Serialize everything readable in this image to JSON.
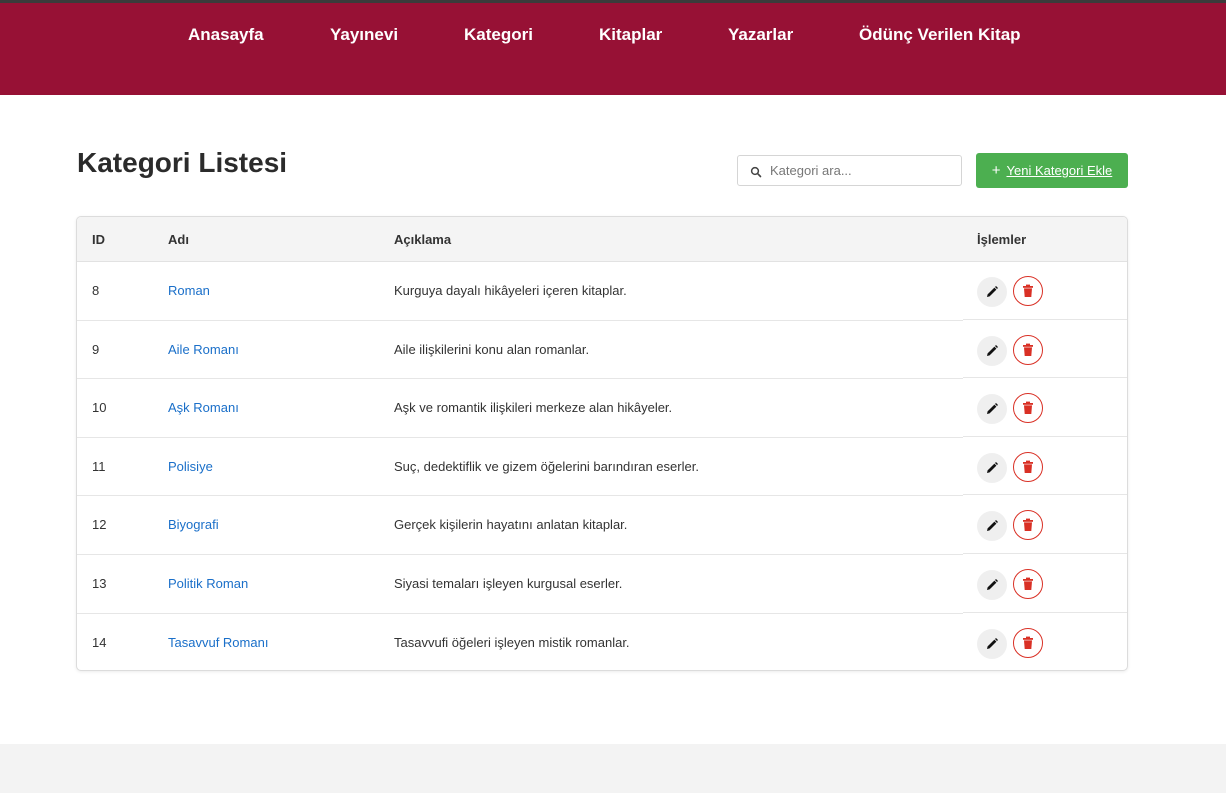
{
  "nav": {
    "items": [
      {
        "label": "Anasayfa"
      },
      {
        "label": "Yayınevi"
      },
      {
        "label": "Kategori"
      },
      {
        "label": "Kitaplar"
      },
      {
        "label": "Yazarlar"
      },
      {
        "label": "Ödünç Verilen Kitap"
      }
    ]
  },
  "page": {
    "title": "Kategori Listesi"
  },
  "search": {
    "placeholder": "Kategori ara...",
    "value": "",
    "icon": "search-icon"
  },
  "add_button": {
    "icon": "plus-icon",
    "label": "Yeni Kategori Ekle"
  },
  "table": {
    "headers": {
      "id": "ID",
      "name": "Adı",
      "description": "Açıklama",
      "actions": "İşlemler"
    },
    "rows": [
      {
        "id": "8",
        "name": "Roman",
        "description": "Kurguya dayalı hikâyeleri içeren kitaplar."
      },
      {
        "id": "9",
        "name": "Aile Romanı",
        "description": "Aile ilişkilerini konu alan romanlar."
      },
      {
        "id": "10",
        "name": "Aşk Romanı",
        "description": "Aşk ve romantik ilişkileri merkeze alan hikâyeler."
      },
      {
        "id": "11",
        "name": "Polisiye",
        "description": "Suç, dedektiflik ve gizem öğelerini barındıran eserler."
      },
      {
        "id": "12",
        "name": "Biyografi",
        "description": "Gerçek kişilerin hayatını anlatan kitaplar."
      },
      {
        "id": "13",
        "name": "Politik Roman",
        "description": "Siyasi temaları işleyen kurgusal eserler."
      },
      {
        "id": "14",
        "name": "Tasavvuf Romanı",
        "description": "Tasavvufi öğeleri işleyen mistik romanlar."
      }
    ]
  },
  "colors": {
    "header_bg": "#971135",
    "accent_green": "#4caf50",
    "link_blue": "#1a6fc9",
    "delete_red": "#d93025"
  }
}
